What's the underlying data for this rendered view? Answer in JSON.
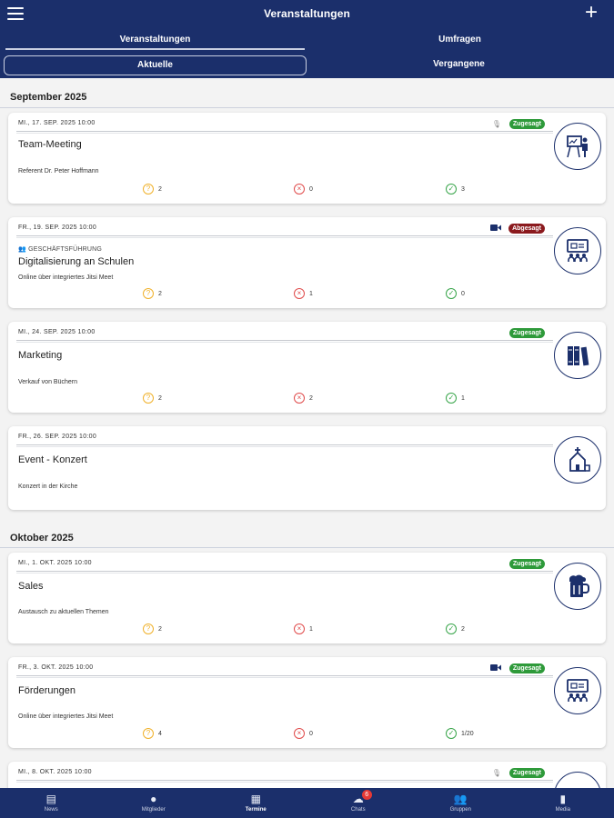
{
  "header": {
    "title": "Veranstaltungen",
    "menu_icon": "hamburger-icon",
    "add_icon": "plus-icon",
    "add_label": "+"
  },
  "tabs": [
    {
      "label": "Veranstaltungen",
      "active": true
    },
    {
      "label": "Umfragen",
      "active": false
    }
  ],
  "subtabs": [
    {
      "label": "Aktuelle",
      "active": true
    },
    {
      "label": "Vergangene",
      "active": false
    }
  ],
  "months": [
    "September 2025",
    "Oktober 2025"
  ],
  "events": [
    {
      "date": "MI., 17. SEP. 2025 10:00",
      "title": "Team-Meeting",
      "desc": "Referent Dr. Peter Hoffmann",
      "status": "Zugesagt",
      "status_color": "#2e9a3a",
      "type_icon": "microphone-icon",
      "avatar": "presentation-icon",
      "maybe": "2",
      "no": "0",
      "yes": "3"
    },
    {
      "date": "FR., 19. SEP. 2025 10:00",
      "group": "GESCHÄFTSFÜHRUNG",
      "title": "Digitalisierung an Schulen",
      "desc": "Online über integriertes Jitsi Meet",
      "status": "Abgesagt",
      "status_color": "#8b1a1e",
      "type_icon": "video-icon",
      "avatar": "video-meeting-icon",
      "maybe": "2",
      "no": "1",
      "yes": "0"
    },
    {
      "date": "MI., 24. SEP. 2025 10:00",
      "title": "Marketing",
      "desc": "Verkauf von Büchern",
      "status": "Zugesagt",
      "status_color": "#2e9a3a",
      "avatar": "books-icon",
      "maybe": "2",
      "no": "2",
      "yes": "1"
    },
    {
      "date": "FR., 26. SEP. 2025 10:00",
      "title": "Event - Konzert",
      "desc": "Konzert in der Kirche",
      "avatar": "church-icon"
    },
    {
      "date": "MI., 1. OKT. 2025 10:00",
      "title": "Sales",
      "desc": "Austausch zu aktuellen Themen",
      "status": "Zugesagt",
      "status_color": "#2e9a3a",
      "avatar": "beer-icon",
      "maybe": "2",
      "no": "1",
      "yes": "2"
    },
    {
      "date": "FR., 3. OKT. 2025 10:00",
      "title": "Förderungen",
      "desc": "Online über integriertes Jitsi Meet",
      "status": "Zugesagt",
      "status_color": "#2e9a3a",
      "type_icon": "video-icon",
      "avatar": "video-meeting-icon",
      "maybe": "4",
      "no": "0",
      "yes": "1/20"
    },
    {
      "date": "MI., 8. OKT. 2025 10:00",
      "status": "Zugesagt",
      "status_color": "#2e9a3a",
      "type_icon": "microphone-icon",
      "avatar": "group-icon"
    }
  ],
  "nav": [
    {
      "label": "News",
      "icon": "news-icon",
      "active": false
    },
    {
      "label": "Mitglieder",
      "icon": "person-icon",
      "active": false
    },
    {
      "label": "Termine",
      "icon": "calendar-icon",
      "active": true
    },
    {
      "label": "Chats",
      "icon": "chat-icon",
      "active": false,
      "badge": "6"
    },
    {
      "label": "Gruppen",
      "icon": "people-icon",
      "active": false
    },
    {
      "label": "Media",
      "icon": "media-icon",
      "active": false
    }
  ],
  "colors": {
    "primary": "#1b2f6b",
    "accepted": "#2e9a3a",
    "declined": "#8b1a1e",
    "maybe": "#f0b12a",
    "no": "#e04b4b",
    "yes": "#38a54a"
  }
}
